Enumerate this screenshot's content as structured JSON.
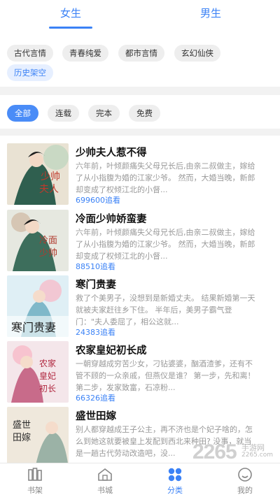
{
  "tabs": {
    "female": "女生",
    "male": "男生"
  },
  "categories": [
    "古代言情",
    "青春纯爱",
    "都市言情",
    "玄幻仙侠",
    "历史架空"
  ],
  "filters": [
    "全部",
    "连载",
    "完本",
    "免费"
  ],
  "books": [
    {
      "title": "少帅夫人惹不得",
      "desc": "六年前，叶倾颜痛失父母兄长后,由亲二叔做主，嫁给了从小指腹为婚的江家少爷。 然而，大婚当晚，新郎却变成了权倾江北的小督...",
      "count": "699600追看"
    },
    {
      "title": "冷面少帅娇蛮妻",
      "desc": "六年前，叶倾颜痛失父母兄长后,由亲二叔做主，嫁给了从小指腹为婚的江家少爷。 然而，大婚当晚，新郎却变成了权倾江北的小督...",
      "count": "88510追看"
    },
    {
      "title": "寒门贵妻",
      "desc": "救了个美男子，没想到是新婚丈夫。 结果新婚第一天就被夫家赶往乡下住。 半年后，美男子霸气登门：\"夫人委屈了，相公这就...",
      "count": "24383追看"
    },
    {
      "title": "农家皇妃初长成",
      "desc": "一朝穿越成穷苦少女，刁钻婆婆，酗酒渣爹，还有不管不顾的一众亲戚，但燕仪是谁？ 第一步，先和离！第二步，发家致富，石凉粉...",
      "count": "66326追看"
    },
    {
      "title": "盛世田嫁",
      "desc": "别人都穿越成王子公主，再不济也是个妃子啥的，怎么到她这就要被皇上发配到西北来种田? 没事，就当是一趟古代劳动改造吧，没...",
      "count": ""
    }
  ],
  "nav": [
    {
      "label": "书架",
      "icon": "bookshelf-icon"
    },
    {
      "label": "书城",
      "icon": "bookstore-icon"
    },
    {
      "label": "分类",
      "icon": "category-icon"
    },
    {
      "label": "我的",
      "icon": "profile-icon"
    }
  ],
  "watermark": {
    "number": "2265",
    "text": "手游网",
    "url": "2265.com"
  },
  "colors": {
    "accent": "#3b82f6",
    "chip_bg": "#eeeeee",
    "divider": "#f2f2f2"
  }
}
